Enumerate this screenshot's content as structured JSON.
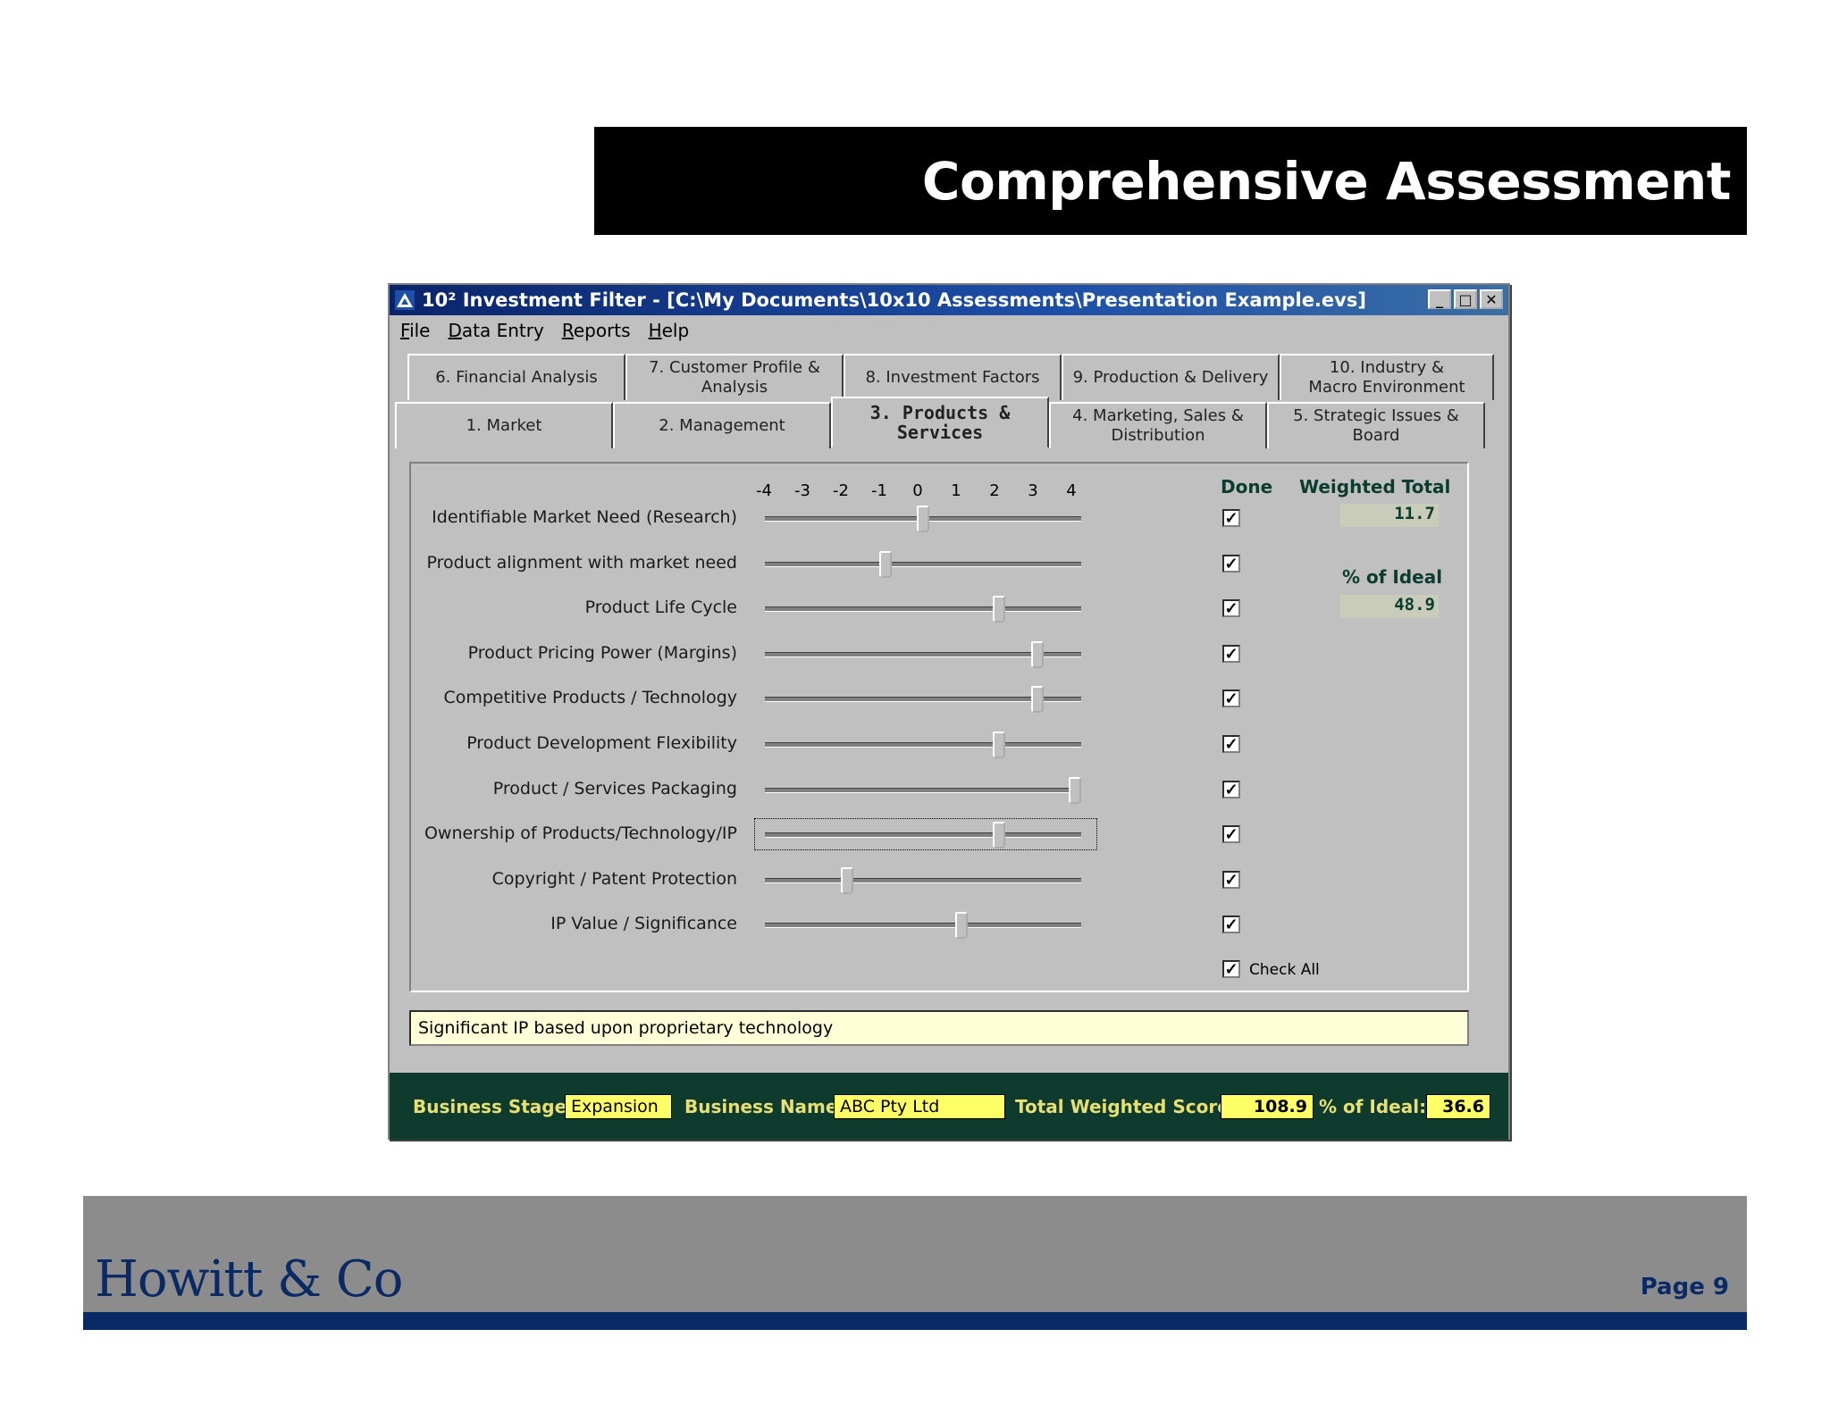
{
  "slide": {
    "title": "Comprehensive Assessment",
    "logo": "Howitt & Co",
    "page": "Page 9",
    "colors": {
      "title_bg": "#000000",
      "footer_bg": "#8c8c8c",
      "brand_navy": "#0a2a66"
    }
  },
  "window": {
    "title": "10² Investment Filter - [C:\\My Documents\\10x10 Assessments\\Presentation Example.evs]",
    "buttons": {
      "minimize": "_",
      "maximize": "□",
      "close": "✕"
    },
    "menu": [
      "File",
      "Data Entry",
      "Reports",
      "Help"
    ]
  },
  "tabs": {
    "back_row": [
      "6. Financial Analysis",
      "7. Customer Profile & Analysis",
      "8. Investment Factors",
      "9. Production & Delivery",
      "10. Industry & Macro Environment"
    ],
    "front_row": [
      "1. Market",
      "2. Management",
      "3. Products & Services",
      "4. Marketing, Sales & Distribution",
      "5. Strategic Issues & Board"
    ],
    "active": "3. Products & Services"
  },
  "scale": {
    "ticks": [
      "-4",
      "-3",
      "-2",
      "-1",
      "0",
      "1",
      "2",
      "3",
      "4"
    ],
    "min": -4,
    "max": 4
  },
  "columns": {
    "done": "Done",
    "weighted_total": "Weighted Total",
    "pct_ideal": "% of Ideal"
  },
  "criteria": [
    {
      "label": "Identifiable Market Need (Research)",
      "value": 0,
      "done": true
    },
    {
      "label": "Product alignment with market need",
      "value": -1,
      "done": true
    },
    {
      "label": "Product Life Cycle",
      "value": 2,
      "done": true
    },
    {
      "label": "Product Pricing Power (Margins)",
      "value": 3,
      "done": true
    },
    {
      "label": "Competitive Products / Technology",
      "value": 3,
      "done": true
    },
    {
      "label": "Product Development Flexibility",
      "value": 2,
      "done": true
    },
    {
      "label": "Product / Services Packaging",
      "value": 4,
      "done": true
    },
    {
      "label": "Ownership of Products/Technology/IP",
      "value": 2,
      "done": true,
      "focused": true
    },
    {
      "label": "Copyright / Patent Protection",
      "value": -2,
      "done": true
    },
    {
      "label": "IP Value / Significance",
      "value": 1,
      "done": true
    }
  ],
  "totals": {
    "weighted_total": "11.7",
    "pct_ideal": "48.9"
  },
  "check_all": {
    "label": "Check All",
    "checked": true
  },
  "comment": "Significant IP based upon proprietary technology",
  "status_bar": {
    "stage_label": "Business Stage:",
    "stage_value": "Expansion",
    "name_label": "Business Name:",
    "name_value": "ABC Pty Ltd",
    "score_label": "Total Weighted Score:",
    "score_value": "108.9",
    "ideal_label": "% of Ideal:",
    "ideal_value": "36.6"
  }
}
